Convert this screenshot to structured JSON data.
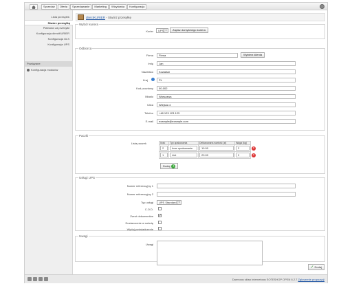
{
  "nav": {
    "tabs": [
      {
        "label": "Sprzedaż"
      },
      {
        "label": "Oferta"
      },
      {
        "label": "Sprzedawanie"
      },
      {
        "label": "Marketing"
      },
      {
        "label": "Wizytówka"
      },
      {
        "label": "Konfiguracja"
      }
    ]
  },
  "sidebar": {
    "items": [
      {
        "label": "Lista przesyłek"
      },
      {
        "label": "Stwórz przesyłkę"
      },
      {
        "label": "Płatności za przesyłki"
      },
      {
        "label": "Konfiguracja directKURIER"
      },
      {
        "label": "Konfiguracja GLS"
      },
      {
        "label": "Konfiguracja UPS"
      }
    ],
    "heading": "Powiązane",
    "sub_label": "Konfiguracja modułów"
  },
  "header": {
    "link": "directKURIER",
    "suffix": " - Stwórz przesyłkę"
  },
  "courier": {
    "legend": "Wybór kuriera",
    "label": "Kurier",
    "value": "UPS",
    "default_button": "Zapisz domyślnego kuriera"
  },
  "recipient": {
    "legend": "Odbiorca",
    "firm_label": "Firma",
    "firm_value": "Firma",
    "choose_client": "Wybierz klienta",
    "name_label": "Imię",
    "name_value": "Jan",
    "surname_label": "Nazwisko",
    "surname_value": "Kowalski",
    "country_label": "Kraj",
    "country_value": "PL",
    "postal_label": "Kod pocztowy",
    "postal_value": "00-002",
    "city_label": "Miasto",
    "city_value": "Warszawa",
    "street_label": "Ulica",
    "street_value": "Wiejska 4",
    "phone_label": "Telefon",
    "phone_value": "+48 123 123 123",
    "email_label": "E-mail",
    "email_value": "example@example.com"
  },
  "parcels": {
    "legend": "Paczki",
    "list_label": "Lista paczek",
    "columns": [
      "Ilość",
      "Typ opakowania",
      "Deklarowana wartość (zł)",
      "Waga (kg)"
    ],
    "rows": [
      {
        "qty": "2",
        "type": "Inne opakowanie",
        "value": "19.00",
        "weight": "2"
      },
      {
        "qty": "1",
        "type": "List",
        "value": "20.00",
        "weight": "2"
      }
    ],
    "add_label": "Dodaj"
  },
  "services": {
    "legend": "Usługi UPS",
    "ref1_label": "Numer referencyjny 1",
    "ref2_label": "Numer referencyjny 2",
    "type_label": "Typ usługi",
    "type_value": "UPS Standard",
    "cod_label": "C.O.D.",
    "docs_label": "Zwrot dokumentów",
    "saturday_label": "Dostarczenie w sobotę",
    "morning_label": "Wydaj poświadczenie"
  },
  "notes": {
    "legend": "Uwagi",
    "label": "Uwagi"
  },
  "actions": {
    "save_label": "Dodaj"
  },
  "footer": {
    "text": "Darmowy sklep internetowy SOTESHOP OPEN 6.2.7",
    "link": "Zgłoszenie propozycji"
  }
}
